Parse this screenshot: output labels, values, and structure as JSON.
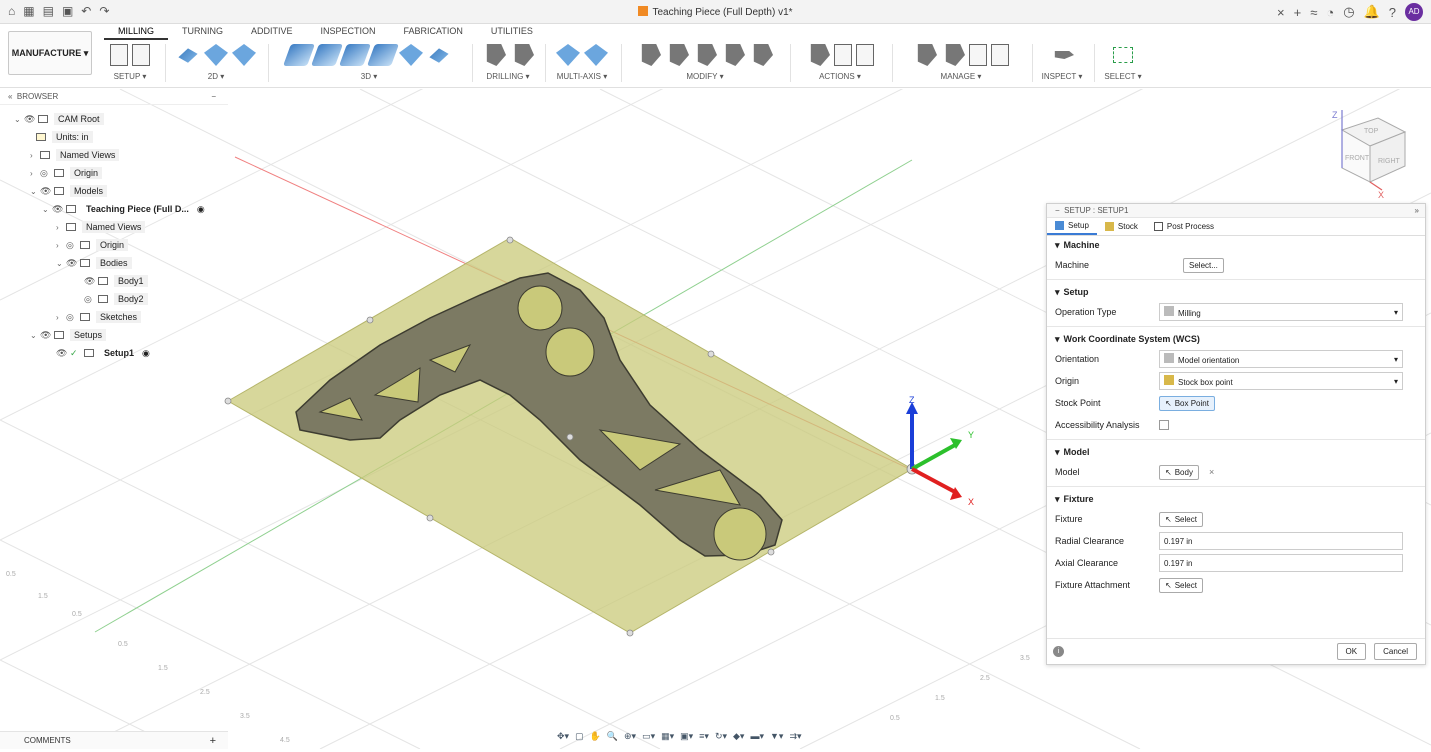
{
  "app": {
    "title": "Teaching Piece (Full Depth) v1*",
    "user_initials": "AD",
    "workspace": "MANUFACTURE",
    "colors": {
      "accent": "#3a7bd5",
      "avatar": "#6a2ea0",
      "stock": "#c9c97a",
      "part": "#7c7a63"
    }
  },
  "ribbon": {
    "tabs": [
      "MILLING",
      "TURNING",
      "ADDITIVE",
      "INSPECTION",
      "FABRICATION",
      "UTILITIES"
    ],
    "active_tab": "MILLING",
    "groups": [
      "SETUP",
      "2D",
      "3D",
      "DRILLING",
      "MULTI-AXIS",
      "MODIFY",
      "ACTIONS",
      "MANAGE",
      "INSPECT",
      "SELECT"
    ]
  },
  "browser": {
    "title": "BROWSER",
    "items": [
      {
        "label": "CAM Root"
      },
      {
        "label": "Units: in"
      },
      {
        "label": "Named Views"
      },
      {
        "label": "Origin"
      },
      {
        "label": "Models"
      },
      {
        "label": "Teaching Piece (Full D..."
      },
      {
        "label": "Named Views"
      },
      {
        "label": "Origin"
      },
      {
        "label": "Bodies"
      },
      {
        "label": "Body1"
      },
      {
        "label": "Body2"
      },
      {
        "label": "Sketches"
      },
      {
        "label": "Setups"
      },
      {
        "label": "Setup1"
      }
    ]
  },
  "panel": {
    "title": "SETUP : SETUP1",
    "tabs": [
      "Setup",
      "Stock",
      "Post Process"
    ],
    "sections": {
      "machine": "Machine",
      "setup": "Setup",
      "wcs": "Work Coordinate System (WCS)",
      "model": "Model",
      "fixture": "Fixture"
    },
    "fields": {
      "machine_label": "Machine",
      "machine_btn": "Select...",
      "op_type_label": "Operation Type",
      "op_type_value": "Milling",
      "orientation_label": "Orientation",
      "orientation_value": "Model orientation",
      "origin_label": "Origin",
      "origin_value": "Stock box point",
      "stock_point_label": "Stock Point",
      "stock_point_btn": "Box Point",
      "accessibility_label": "Accessibility Analysis",
      "model_label": "Model",
      "model_btn": "Body",
      "fixture_label": "Fixture",
      "fixture_btn": "Select",
      "radial_label": "Radial Clearance",
      "radial_value": "0.197 in",
      "axial_label": "Axial Clearance",
      "axial_value": "0.197 in",
      "attach_label": "Fixture Attachment",
      "attach_btn": "Select"
    },
    "ok": "OK",
    "cancel": "Cancel"
  },
  "viewcube": {
    "top": "TOP",
    "front": "FRONT",
    "right": "RIGHT",
    "z": "Z",
    "x": "X"
  },
  "triad": {
    "x": "X",
    "y": "Y",
    "z": "Z"
  },
  "grid_labels": [
    "0.5",
    "1.5",
    "0.5",
    "0.5",
    "1.5",
    "2.5",
    "3.5",
    "0.5",
    "1.5",
    "2.5",
    "3.5",
    "4.5"
  ],
  "comments": "COMMENTS"
}
